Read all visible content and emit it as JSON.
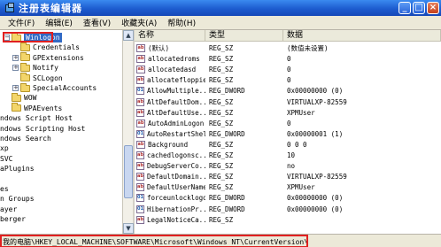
{
  "window": {
    "title": "注册表编辑器",
    "buttons": [
      "_",
      "□",
      "×"
    ]
  },
  "menu": [
    "文件(F)",
    "编辑(E)",
    "查看(V)",
    "收藏夹(A)",
    "帮助(H)"
  ],
  "tree": {
    "items": [
      {
        "label": "Winlogon",
        "expander": "−",
        "selected": true
      },
      {
        "label": "Credentials",
        "expander": ""
      },
      {
        "label": "GPExtensions",
        "expander": "+"
      },
      {
        "label": "Notify",
        "expander": "+"
      },
      {
        "label": "SCLogon",
        "expander": ""
      },
      {
        "label": "SpecialAccounts",
        "expander": "+"
      },
      {
        "label": "WOW",
        "expander": ""
      },
      {
        "label": "WPAEvents",
        "expander": ""
      },
      {
        "label": "ndows Script Host",
        "expander": ""
      },
      {
        "label": "ndows Scripting Host",
        "expander": ""
      },
      {
        "label": "ndows Search",
        "expander": ""
      },
      {
        "label": "xp",
        "expander": ""
      },
      {
        "label": "SVC",
        "expander": ""
      },
      {
        "label": "aPlugins",
        "expander": ""
      },
      {
        "label": "",
        "expander": ""
      },
      {
        "label": "es",
        "expander": ""
      },
      {
        "label": "n Groups",
        "expander": ""
      },
      {
        "label": "ayer",
        "expander": ""
      },
      {
        "label": "berger",
        "expander": ""
      }
    ]
  },
  "list": {
    "headers": {
      "name": "名称",
      "type": "类型",
      "data": "数据"
    },
    "rows": [
      {
        "name": "(默认)",
        "type": "REG_SZ",
        "data": "(数值未设置)",
        "icon": "ab"
      },
      {
        "name": "allocatedroms",
        "type": "REG_SZ",
        "data": "0",
        "icon": "ab"
      },
      {
        "name": "allocatedasd",
        "type": "REG_SZ",
        "data": "0",
        "icon": "ab"
      },
      {
        "name": "allocatefloppies",
        "type": "REG_SZ",
        "data": "0",
        "icon": "ab"
      },
      {
        "name": "AllowMultiple...",
        "type": "REG_DWORD",
        "data": "0x00000000 (0)",
        "icon": "01"
      },
      {
        "name": "AltDefaultDom...",
        "type": "REG_SZ",
        "data": "VIRTUALXP-82559",
        "icon": "ab"
      },
      {
        "name": "AltDefaultUse...",
        "type": "REG_SZ",
        "data": "XPMUser",
        "icon": "ab"
      },
      {
        "name": "AutoAdminLogon",
        "type": "REG_SZ",
        "data": "0",
        "icon": "ab"
      },
      {
        "name": "AutoRestartShell",
        "type": "REG_DWORD",
        "data": "0x00000001 (1)",
        "icon": "01"
      },
      {
        "name": "Background",
        "type": "REG_SZ",
        "data": "0 0 0",
        "icon": "ab"
      },
      {
        "name": "cachedlogonsc...",
        "type": "REG_SZ",
        "data": "10",
        "icon": "ab"
      },
      {
        "name": "DebugServerCo...",
        "type": "REG_SZ",
        "data": "no",
        "icon": "ab"
      },
      {
        "name": "DefaultDomain...",
        "type": "REG_SZ",
        "data": "VIRTUALXP-82559",
        "icon": "ab"
      },
      {
        "name": "DefaultUserName",
        "type": "REG_SZ",
        "data": "XPMUser",
        "icon": "ab"
      },
      {
        "name": "forceunlocklogon",
        "type": "REG_DWORD",
        "data": "0x00000000 (0)",
        "icon": "01"
      },
      {
        "name": "HibernationPr...",
        "type": "REG_DWORD",
        "data": "0x00000000 (0)",
        "icon": "01"
      },
      {
        "name": "LegalNoticeCa...",
        "type": "REG_SZ",
        "data": "",
        "icon": "ab"
      }
    ]
  },
  "status": {
    "path": "我的电脑\\HKEY_LOCAL_MACHINE\\SOFTWARE\\Microsoft\\Windows NT\\CurrentVersion\\Winlogon"
  }
}
